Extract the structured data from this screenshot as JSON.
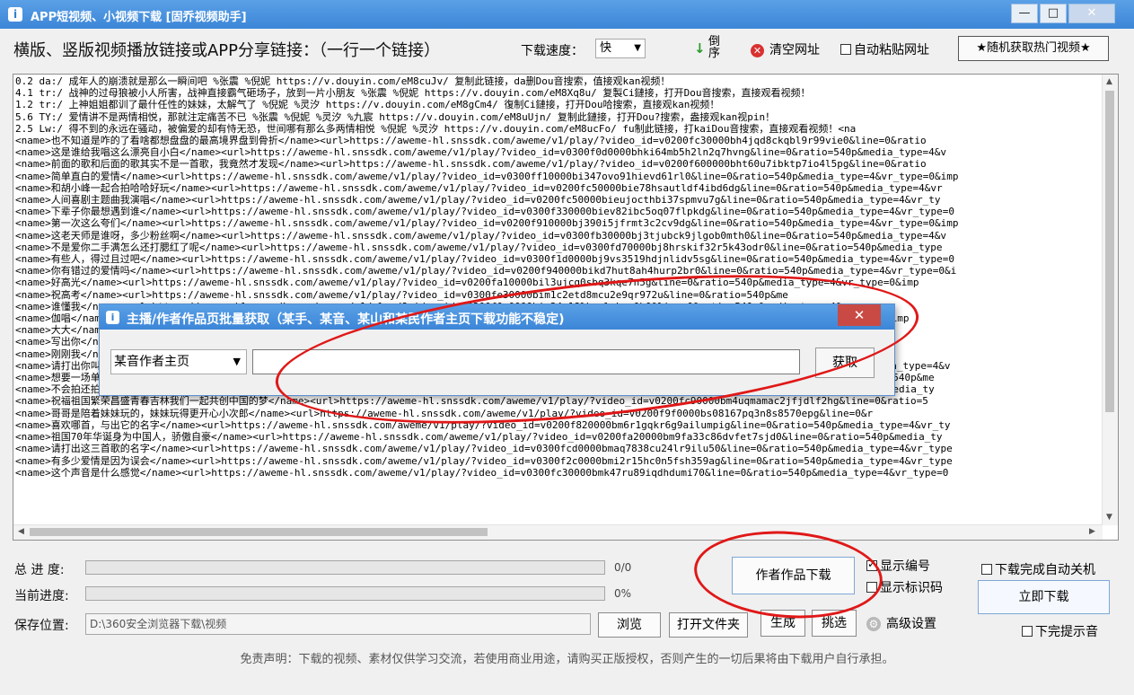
{
  "window": {
    "title": "APP短视频、小视频下载 [固乔视频助手]",
    "app_icon": "app-logo-icon",
    "controls": [
      "minimize-icon",
      "maximize-icon",
      "close-icon"
    ]
  },
  "header": {
    "label": "横版、竖版视频播放链接或APP分享链接：（一行一个链接）",
    "speed_label": "下载速度：",
    "speed_value": "快",
    "sort_label": "倒序",
    "clear_label": "清空网址",
    "auto_paste_label": "自动粘贴网址",
    "auto_paste_checked": false,
    "hot_button_label": "★随机获取热门视频★"
  },
  "links": [
    "0.2 da:/ 成年人的崩溃就是那么一瞬间吧 %张震  %倪妮  https://v.douyin.com/eM8cuJv/ 复制此链接，da删Dou音搜索，值接观kan视频！",
    "4.1 tr:/ 战神的过母狼被小人所害，战神直接霸气砸场子，放到一片小朋友 %张震  %倪妮  https://v.douyin.com/eM8Xq8u/ 复製Ci鏈接，打开Dou音搜索，直接观看视频！",
    "1.2 tr:/ 上神姐姐都训了最什任性的妹妹，太解气了 %倪妮  %灵汐  https://v.douyin.com/eM8gCm4/ 復制Ci鏈接，打开Dou哈搜索，直接观kan视频！",
    "5.6 TY:/ 爱情讲不是两情相悦，那就注定痛苦不已 %张震  %倪妮  %灵汐  %九宸  https://v.douyin.com/eM8uUjn/ 复制此鏈接，打开Dou?搜索，盎接观kan视pin！",
    "2.5 Lw:/ 得不到的永远在骚动，被偏爱的却有恃无恐，世间哪有那么多两情相悦 %倪妮  %灵汐  https://v.douyin.com/eM8ucFo/ fu制此链接，打kaiDou音搜索，直接观看视频！<na",
    "<name>也不知道是咋的了看啥都想盘盘的最高境界盘到骨折</name><url>https://aweme-hl.snssdk.com/aweme/v1/play/?video_id=v0200fc30000bh4jqd8ckqbl9r99vie0&line=0&ratio",
    "<name>这是谁给我唱这么漂亮自小白</name><url>https://aweme-hl.snssdk.com/aweme/v1/play/?video_id=v0300f0d0000bhki64mb5h2ln2q7hvng&line=0&ratio=540p&media_type=4&v",
    "<name>前面的歌和后面的歌其实不是一首歌，我竟然才发现</name><url>https://aweme-hl.snssdk.com/aweme/v1/play/?video_id=v0200f600000bht60u7ibktp7io4l5pg&line=0&ratio",
    "<name>简单直白的爱情</name><url>https://aweme-hl.snssdk.com/aweme/v1/play/?video_id=v0300ff10000bi347ovo91hievd61rl0&line=0&ratio=540p&media_type=4&vr_type=0&imp",
    "<name>和胡小峰一起合拍哈哈好玩</name><url>https://aweme-hl.snssdk.com/aweme/v1/play/?video_id=v0200fc50000bie78hsautldf4ibd6dg&line=0&ratio=540p&media_type=4&vr",
    "<name>人间喜剧主题曲我演唱</name><url>https://aweme-hl.snssdk.com/aweme/v1/play/?video_id=v0200fc50000bieujocthbi37spmvu7g&line=0&ratio=540p&media_type=4&vr_ty",
    "<name>下辈子你最想遇到谁</name><url>https://aweme-hl.snssdk.com/aweme/v1/play/?video_id=v0300f330000biev82ibc5oq07flpkdg&line=0&ratio=540p&media_type=4&vr_type=0",
    "<name>第一次这么夸们</name><url>https://aweme-hl.snssdk.com/aweme/v1/play/?video_id=v0200f910000bj390i5jfrmt3c2cv9dg&line=0&ratio=540p&media_type=4&vr_type=0&imp",
    "<name>这老天师是谁呀，多少粉丝啊</name><url>https://aweme-hl.snssdk.com/aweme/v1/play/?video_id=v0300fb30000bj3tjubck9jlgob0mth0&line=0&ratio=540p&media_type=4&v",
    "<name>不是爱你二手满怎么还打腮红了呢</name><url>https://aweme-hl.snssdk.com/aweme/v1/play/?video_id=v0300fd70000bj8hrskif32r5k43odr0&line=0&ratio=540p&media_type",
    "<name>有些人，得过且过吧</name><url>https://aweme-hl.snssdk.com/aweme/v1/play/?video_id=v0300f1d0000bj9vs3519hdjnlidv5sg&line=0&ratio=540p&media_type=4&vr_type=0",
    "<name>你有错过的爱情吗</name><url>https://aweme-hl.snssdk.com/aweme/v1/play/?video_id=v0200f940000bikd7hut8ah4hurp2br0&line=0&ratio=540p&media_type=4&vr_type=0&i",
    "<name>好高光</name><url>https://aweme-hl.snssdk.com/aweme/v1/play/?video_id=v0200fa10000bil3ujcq0sbq3kqe7n5g&line=0&ratio=540p&media_type=4&vr_type=0&imp",
    "<name>祝高考</name><url>https://aweme-hl.snssdk.com/aweme/v1/play/?video_id=v0300fe30000bim1c2etd8mcu2e9qr972u&line=0&ratio=540p&me",
    "<name>谁懂我</name><url>https://aweme-hl.snssdk.com/aweme/v1/play/?video_id=v0200f0e0000bip34r18lkqplmkcc0b0&line=0&ratio=540p&media_type=4&vr",
    "<name>伽唱</name><url>https://aweme-hl.snssdk.com/aweme/v1/play/?video_id=v0300f7a0000biq9ul6kp2ksnqdc5cjg&line=0&ratio=540p&media_type=4&vr_type=0&imp",
    "<name>大大</name><url>https://aweme-hl.snssdk.com/aweme/v1/play/?video_id=v0200f330000bir01ffu4ojrmvlq0bc0&line=0&ratio=540p&media_type=4&vr_type=0",
    "<name>写出你</name><url>https://aweme-hl.snssdk.com/aweme/v1/play/?video_id=v0300fc80000bis1l65i2lco8ft2hnq0&line=0&ratio=540p&media_type=4&v",
    "<name>刚刚我</name><url>https://aweme-hl.snssdk.com/aweme/v1/play/?video_id=v0200f7c0000bit6h7mi4k1jbe3kuah7jug&line=0&ratio=540p&medi",
    "<name>请打出你叫giao什么名，哈哈</name><url>https://aweme-hl.snssdk.com/aweme/v1/play/?video_id=v0200fff0000bl5tocj3hortiaq2het0&line=0&ratio=540p&media_type=4&v",
    "<name>想要一场单纯放肆唱歌的演唱会，你会来吗</name><url>https://aweme-hl.snssdk.com/aweme/v1/play/?video_id=v0200ff90000blme46g6h8rqmuit2jp0&line=0&ratio=540p&me",
    "<name>不会拍还拍这么好，上哪说理去哈哈</name><url>https://aweme-hl.snssdk.com/aweme/v1/play/?video_id=v0300fee0000bloek1rjvcl81jg5t7g&line=0&ratio=540p&media_ty",
    "<name>祝福祖国繁荣昌盛青春吉林我们一起共创中国的梦</name><url>https://aweme-hl.snssdk.com/aweme/v1/play/?video_id=v0200fc90000bm4uqmamac2jfjdlf2hg&line=0&ratio=5",
    "<name>哥哥是陪着妹妹玩的，妹妹玩得更开心小次郎</name><url>https://aweme-hl.snssdk.com/aweme/v1/play/?video_id=v0200f9f0000bs08167pq3n8s8570epg&line=0&r",
    "<name>喜欢哪首，与出它的名字</name><url>https://aweme-hl.snssdk.com/aweme/v1/play/?video_id=v0200f820000bm6r1gqkr6g9ailumpig&line=0&ratio=540p&media_type=4&vr_ty",
    "<name>祖国70年华诞身为中国人，骄傲自豪</name><url>https://aweme-hl.snssdk.com/aweme/v1/play/?video_id=v0200fa20000bm9fa33c86dvfet7sjd0&line=0&ratio=540p&media_ty",
    "<name>请打出这三首歌的名字</name><url>https://aweme-hl.snssdk.com/aweme/v1/play/?video_id=v0300fcd0000bmaq7838cu24lr9ilu50&line=0&ratio=540p&media_type=4&vr_type",
    "<name>有多少爱情是因为误会</name><url>https://aweme-hl.snssdk.com/aweme/v1/play/?video_id=v0300f2c0000bmi2r15hc0n5fsh359ag&line=0&ratio=540p&media_type=4&vr_type",
    "<name>这个声音是什么感觉</name><url>https://aweme-hl.snssdk.com/aweme/v1/play/?video_id=v0300fc30000bmk47ru89iqdhdumi70&line=0&ratio=540p&media_type=4&vr_type=0"
  ],
  "dialog": {
    "title": "主播/作者作品页批量获取（某手、某音、某山和某民作者主页下载功能不稳定)",
    "select_value": "某音作者主页",
    "input_value": "",
    "fetch_label": "获取"
  },
  "progress": {
    "total_label": "总 进 度:",
    "total_text": "0/0",
    "total_fraction": 0,
    "current_label": "当前进度:",
    "current_text": "0%",
    "current_fraction": 0
  },
  "save": {
    "label": "保存位置:",
    "path": "D:\\360安全浏览器下载\\视频",
    "browse_label": "浏览",
    "open_folder_label": "打开文件夹"
  },
  "actions": {
    "author_download_label": "作者作品下载",
    "generate_label": "生成",
    "pick_label": "挑选",
    "advanced_label": "高级设置",
    "download_now_label": "立即下载"
  },
  "options": {
    "show_number_label": "显示编号",
    "show_number_checked": true,
    "show_code_label": "显示标识码",
    "show_code_checked": false,
    "auto_shutdown_label": "下载完成自动关机",
    "auto_shutdown_checked": false,
    "finish_prompt_label": "下完提示音",
    "finish_prompt_checked": false
  },
  "disclaimer": "免责声明：下载的视频、素材仅供学习交流，若使用商业用途，请购买正版授权，否则产生的一切后果将由下载用户自行承担。",
  "colors": {
    "titlebar": "#3c86d8",
    "annotation": "#e01818",
    "close": "#c94a45"
  }
}
